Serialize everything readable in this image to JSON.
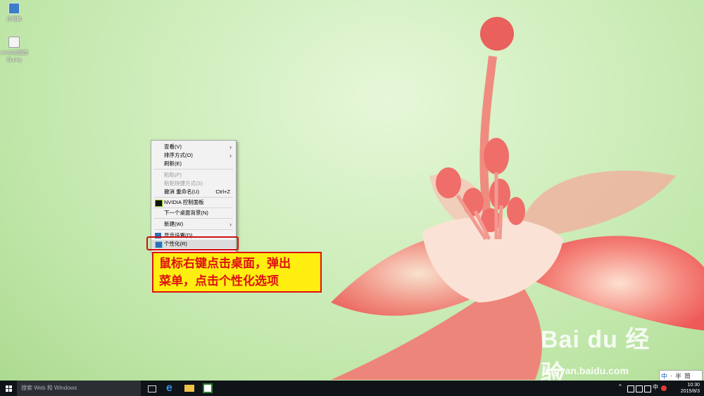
{
  "desktop": {
    "icons": [
      {
        "label": "此电脑",
        "icon": "computer-icon"
      },
      {
        "label": "win10桌面图标.png",
        "icon": "image-file-icon"
      }
    ]
  },
  "context_menu": {
    "items": [
      {
        "label": "查看(V)",
        "submenu": true
      },
      {
        "label": "排序方式(O)",
        "submenu": true
      },
      {
        "label": "刷新(E)"
      },
      {
        "label": "粘贴(P)",
        "disabled": true
      },
      {
        "label": "粘贴快捷方式(S)",
        "disabled": true
      },
      {
        "label": "撤消 重命名(U)",
        "shortcut": "Ctrl+Z"
      },
      {
        "label": "NVIDIA 控制面板",
        "icon": "nvidia-icon"
      },
      {
        "label": "下一个桌面背景(N)"
      },
      {
        "label": "新建(W)",
        "submenu": true
      },
      {
        "label": "显示设置(D)",
        "icon": "display-settings-icon"
      },
      {
        "label": "个性化(R)",
        "icon": "personalize-icon",
        "highlighted": true
      }
    ],
    "submenu_arrow": "›"
  },
  "callout": {
    "line1": "鼠标右键点击桌面，弹出",
    "line2": "菜单，点击个性化选项"
  },
  "watermark": {
    "logo": "Bai du 经验",
    "url": "jingyan.baidu.com"
  },
  "ime": {
    "items": [
      "中",
      "·",
      "半",
      "简"
    ]
  },
  "taskbar": {
    "search_placeholder": "搜索 Web 和 Windows",
    "pinned": [
      "task-view-icon",
      "edge-icon",
      "file-explorer-icon",
      "store-icon"
    ],
    "clock_time": "10:30",
    "clock_date": "2015/8/3",
    "tray_ime": "中"
  },
  "colors": {
    "callout_bg": "#ffee10",
    "callout_text": "#dd1111",
    "highlight_border": "#cc1111",
    "taskbar_bg": "#0f1418"
  }
}
